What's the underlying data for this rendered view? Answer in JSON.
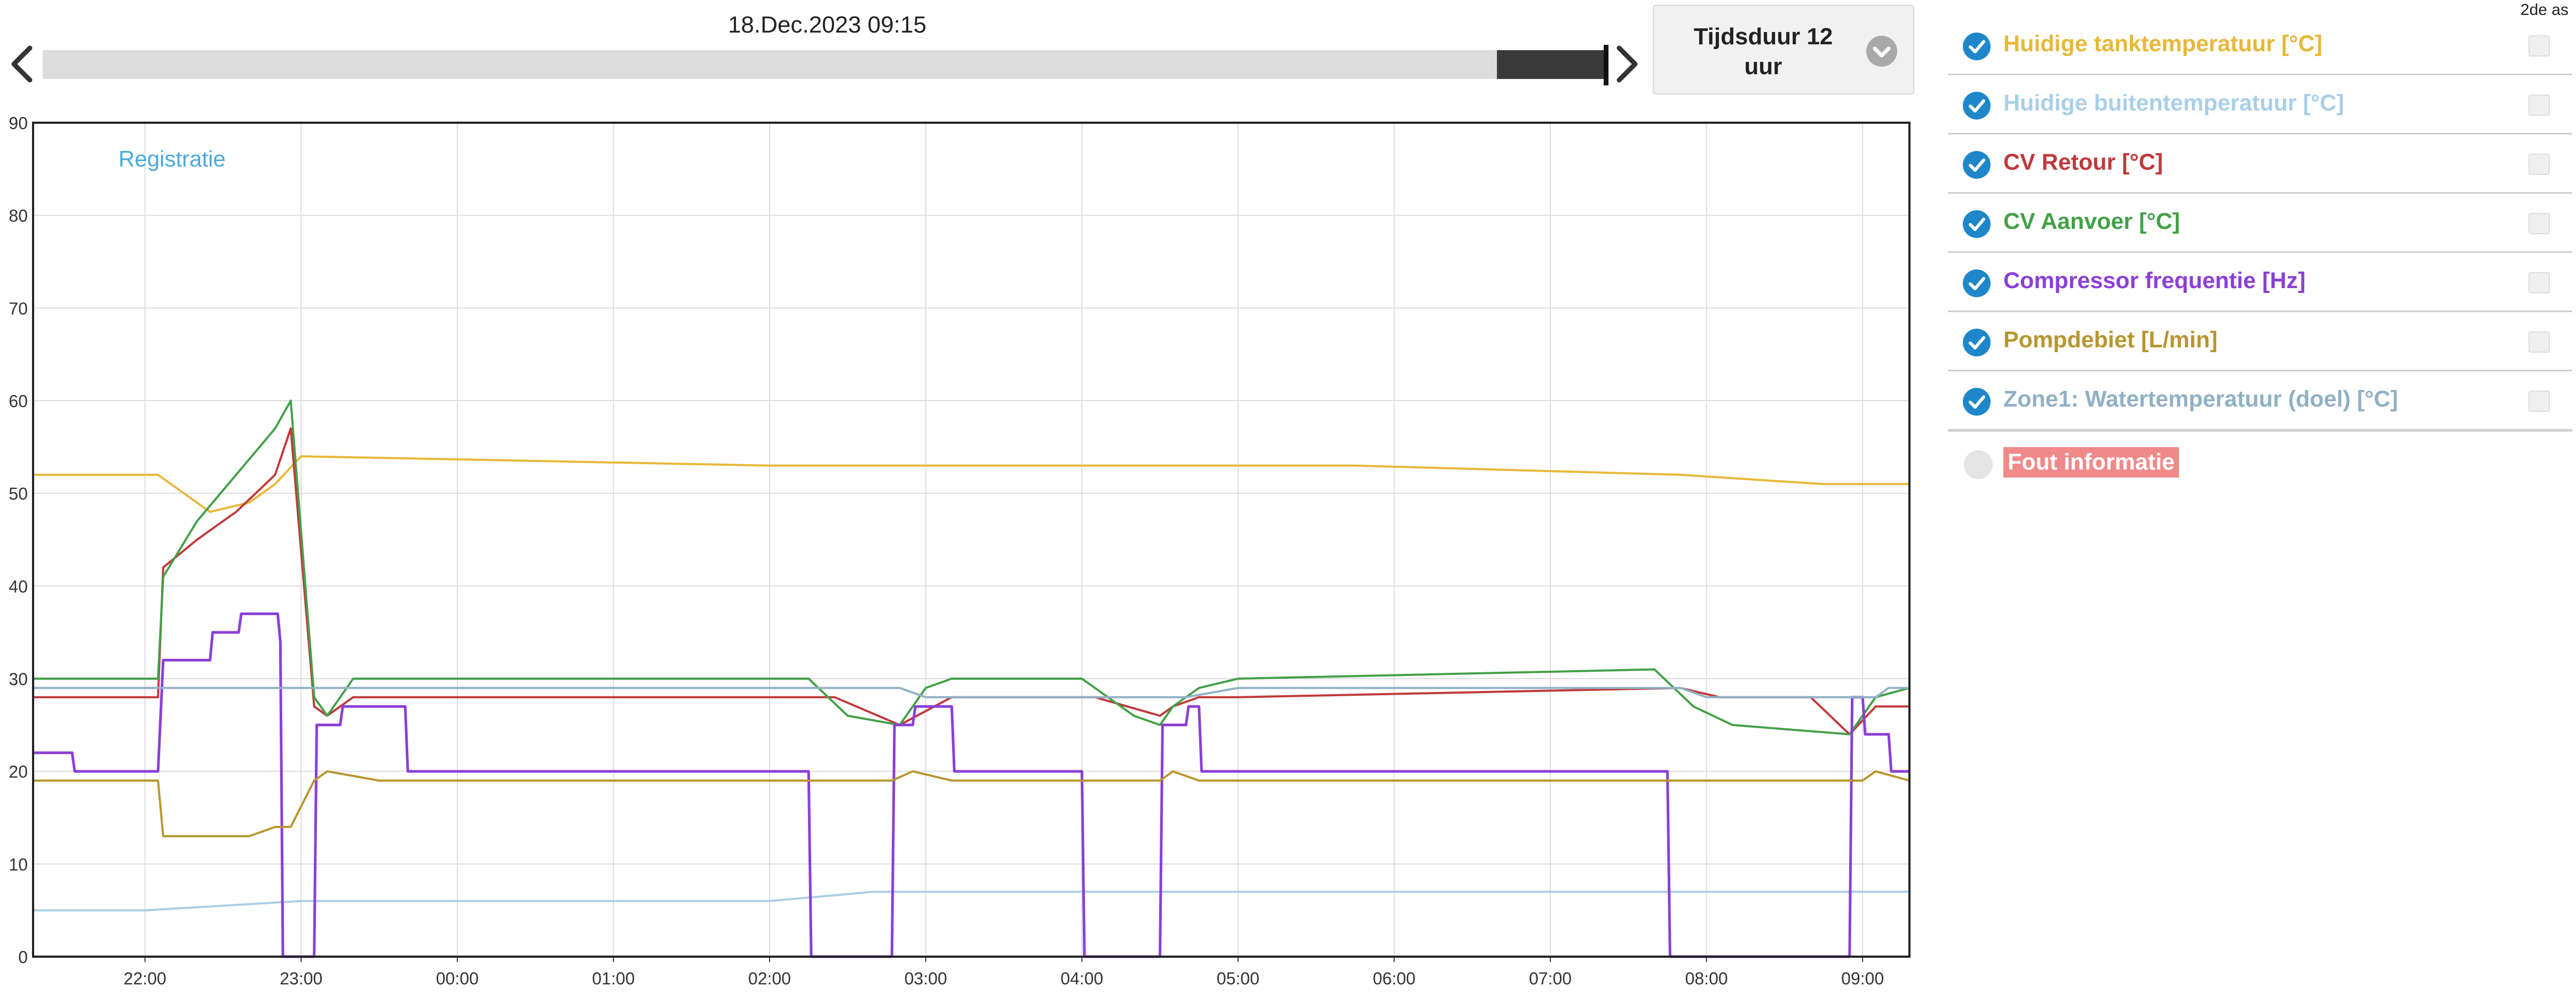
{
  "header": {
    "timestamp": "18.Dec.2023 09:15",
    "duration_label": "Tijdsduur 12 uur"
  },
  "legend": {
    "second_axis_header": "2de as",
    "error_label": "Fout informatie",
    "items": [
      {
        "label": "Huidige tanktemperatuur [°C]",
        "color": "#e8b83a"
      },
      {
        "label": "Huidige buitentemperatuur [°C]",
        "color": "#a9cfe8"
      },
      {
        "label": "CV Retour [°C]",
        "color": "#c0393b"
      },
      {
        "label": "CV Aanvoer [°C]",
        "color": "#43a047"
      },
      {
        "label": "Compressor frequentie [Hz]",
        "color": "#8b3fd6"
      },
      {
        "label": "Pompdebiet [L/min]",
        "color": "#b8962e"
      },
      {
        "label": "Zone1: Watertemperatuur (doel) [°C]",
        "color": "#91b0c4"
      }
    ]
  },
  "chart_data": {
    "type": "line",
    "title": "",
    "xlabel": "",
    "ylabel": "",
    "annotation": "Registratie",
    "x_unit": "hours since 21:17 on 17.Dec.2023",
    "xlim": [
      21.28,
      9.3
    ],
    "ylim": [
      0,
      90
    ],
    "yticks": [
      0,
      10,
      20,
      30,
      40,
      50,
      60,
      70,
      80,
      90
    ],
    "xticks": [
      "22:00",
      "23:00",
      "00:00",
      "01:00",
      "02:00",
      "03:00",
      "04:00",
      "05:00",
      "06:00",
      "07:00",
      "08:00",
      "09:00"
    ],
    "grid": true,
    "series": [
      {
        "name": "Huidige tanktemperatuur [°C]",
        "color": "#e8b83a",
        "x": [
          "21:17",
          "22:05",
          "22:15",
          "22:25",
          "22:40",
          "22:50",
          "23:00",
          "02:00",
          "05:45",
          "07:50",
          "08:45",
          "09:18"
        ],
        "y": [
          52,
          52,
          50,
          48,
          49,
          51,
          54,
          53,
          53,
          52,
          51,
          51
        ]
      },
      {
        "name": "Huidige buitentemperatuur [°C]",
        "color": "#a9cfe8",
        "x": [
          "21:17",
          "22:00",
          "23:00",
          "02:00",
          "02:40",
          "04:00",
          "05:00",
          "08:00",
          "09:18"
        ],
        "y": [
          5,
          5,
          6,
          6,
          7,
          7,
          7,
          7,
          7
        ]
      },
      {
        "name": "CV Retour [°C]",
        "color": "#c0393b",
        "x": [
          "21:17",
          "22:05",
          "22:07",
          "22:20",
          "22:35",
          "22:50",
          "22:56",
          "23:05",
          "23:10",
          "23:20",
          "02:00",
          "02:25",
          "02:50",
          "03:10",
          "03:40",
          "04:05",
          "04:30",
          "04:35",
          "04:45",
          "05:00",
          "07:50",
          "08:05",
          "08:40",
          "08:55",
          "09:05",
          "09:18"
        ],
        "y": [
          28,
          28,
          42,
          45,
          48,
          52,
          57,
          27,
          26,
          28,
          28,
          28,
          25,
          28,
          28,
          28,
          26,
          27,
          28,
          28,
          29,
          28,
          28,
          24,
          27,
          27
        ]
      },
      {
        "name": "CV Aanvoer [°C]",
        "color": "#43a047",
        "x": [
          "21:17",
          "22:05",
          "22:07",
          "22:20",
          "22:35",
          "22:50",
          "22:56",
          "23:05",
          "23:10",
          "23:20",
          "02:15",
          "02:30",
          "02:50",
          "03:00",
          "03:10",
          "04:00",
          "04:20",
          "04:30",
          "04:35",
          "04:45",
          "05:00",
          "07:40",
          "07:55",
          "08:10",
          "08:55",
          "09:05",
          "09:18"
        ],
        "y": [
          30,
          30,
          41,
          47,
          52,
          57,
          60,
          28,
          26,
          30,
          30,
          26,
          25,
          29,
          30,
          30,
          26,
          25,
          27,
          29,
          30,
          31,
          27,
          25,
          24,
          28,
          29
        ]
      },
      {
        "name": "Compressor frequentie [Hz]",
        "color": "#8b3fd6",
        "x": [
          "21:17",
          "21:32",
          "21:33",
          "22:05",
          "22:07",
          "22:25",
          "22:26",
          "22:36",
          "22:37",
          "22:51",
          "22:52",
          "22:53",
          "23:05",
          "23:06",
          "23:15",
          "23:16",
          "23:40",
          "23:41",
          "02:15",
          "02:16",
          "02:47",
          "02:48",
          "02:55",
          "02:56",
          "03:10",
          "03:11",
          "04:00",
          "04:01",
          "04:30",
          "04:31",
          "04:40",
          "04:41",
          "04:45",
          "04:46",
          "07:45",
          "07:46",
          "08:55",
          "08:56",
          "09:00",
          "09:01",
          "09:10",
          "09:11",
          "09:18"
        ],
        "y": [
          22,
          22,
          20,
          20,
          32,
          32,
          35,
          35,
          37,
          37,
          34,
          0,
          0,
          25,
          25,
          27,
          27,
          20,
          20,
          0,
          0,
          25,
          25,
          27,
          27,
          20,
          20,
          0,
          0,
          25,
          25,
          27,
          27,
          20,
          20,
          0,
          0,
          28,
          28,
          24,
          24,
          20,
          20
        ]
      },
      {
        "name": "Pompdebiet [L/min]",
        "color": "#b8962e",
        "x": [
          "21:17",
          "22:05",
          "22:07",
          "22:40",
          "22:50",
          "22:56",
          "23:05",
          "23:10",
          "23:30",
          "02:15",
          "02:47",
          "02:55",
          "03:10",
          "04:30",
          "04:35",
          "04:45",
          "09:00",
          "09:05",
          "09:18"
        ],
        "y": [
          19,
          19,
          13,
          13,
          14,
          14,
          19,
          20,
          19,
          19,
          19,
          20,
          19,
          19,
          20,
          19,
          19,
          20,
          19
        ]
      },
      {
        "name": "Zone1: Watertemperatuur (doel) [°C]",
        "color": "#91b0c4",
        "x": [
          "21:17",
          "02:50",
          "03:00",
          "03:30",
          "04:00",
          "04:40",
          "05:00",
          "07:50",
          "08:00",
          "09:05",
          "09:10",
          "09:18"
        ],
        "y": [
          29,
          29,
          28,
          28,
          28,
          28,
          29,
          29,
          28,
          28,
          29,
          29
        ]
      }
    ]
  }
}
